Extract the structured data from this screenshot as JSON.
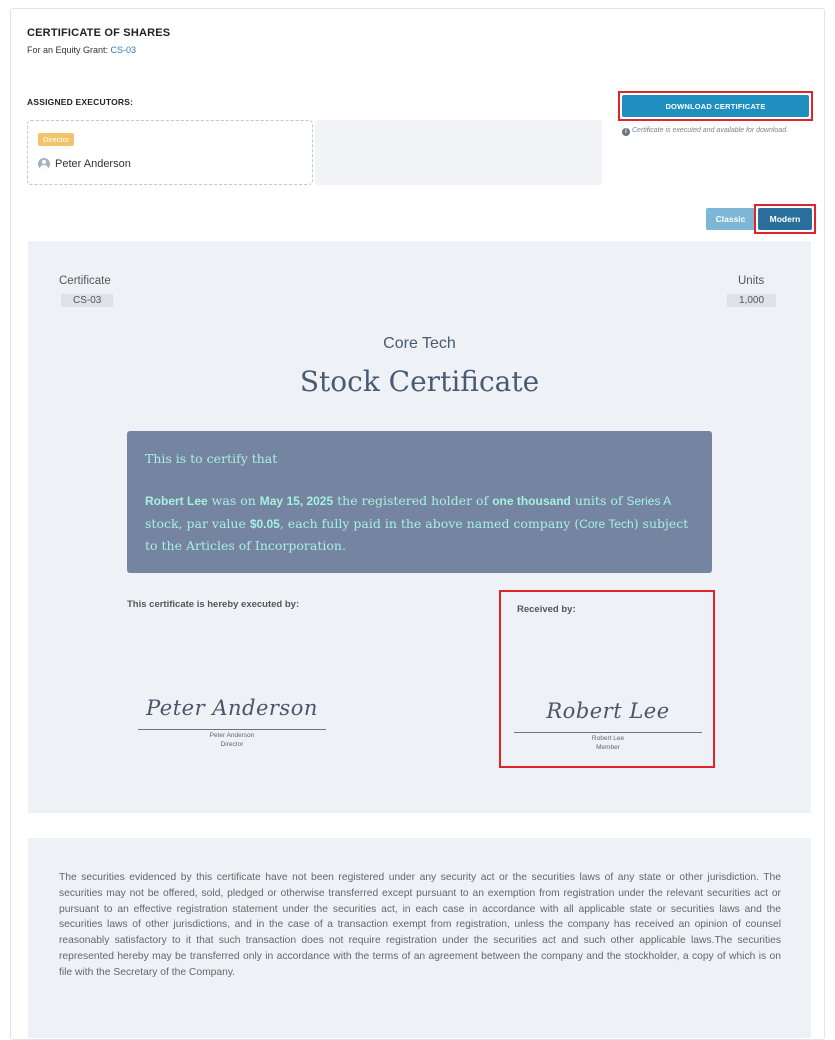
{
  "header": {
    "title": "CERTIFICATE OF SHARES",
    "subtitle_prefix": "For an Equity Grant: ",
    "grant_id": "CS-03"
  },
  "executors": {
    "heading": "ASSIGNED EXECUTORS:",
    "role": "Director",
    "name": "Peter Anderson"
  },
  "download": {
    "button_label": "DOWNLOAD CERTIFICATE",
    "note": "Certificate is executed and available for download."
  },
  "style_toggle": {
    "classic_label": "Classic",
    "modern_label": "Modern",
    "selected": "Modern"
  },
  "certificate": {
    "certificate_label": "Certificate",
    "certificate_value": "CS-03",
    "units_label": "Units",
    "units_value": "1,000",
    "company": "Core Tech",
    "title": "Stock Certificate",
    "intro": "This is to certify that",
    "holder": "Robert Lee",
    "t1": " was on ",
    "date": "May 15, 2025",
    "t2": " the registered holder of ",
    "units_words": "one thousand",
    "t3": " units of ",
    "series": "Series A",
    "t4": " stock, par value ",
    "par_value": "$0.05",
    "t5": ", each fully paid in the above named company (",
    "company_inline": "Core Tech",
    "t6": ") subject to the Articles of Incorporation.",
    "executed_by_label": "This certificate is hereby executed by:",
    "executor_signature": "Peter Anderson",
    "executor_name": "Peter Anderson",
    "executor_role": "Director",
    "received_by_label": "Received by:",
    "receiver_signature": "Robert Lee",
    "receiver_name": "Robert Lee",
    "receiver_role": "Member"
  },
  "legend": {
    "text": "The securities evidenced by this certificate have not been registered under any security act or the securities laws of any state or other jurisdiction. The securities may not be offered, sold, pledged or otherwise transferred except pursuant to an exemption from registration under the relevant securities act or pursuant to an effective registration statement under the securities act, in each case in accordance with all applicable state or securities laws and the securities laws of other jurisdictions, and in the case of a transaction exempt from registration, unless the company has received an opinion of counsel reasonably satisfactory to it that such transaction does not require registration under the securities act and such other applicable laws.The securities represented hereby may be transferred only in accordance with the terms of an agreement between the company and the stockholder, a copy of which is on file with the Secretary of the Company."
  },
  "colors": {
    "accent_blue": "#1f8fc0",
    "highlight_red": "#e0242c",
    "statement_bg": "#7584a0",
    "statement_text": "#a6f1e2",
    "badge": "#f2c36b"
  }
}
